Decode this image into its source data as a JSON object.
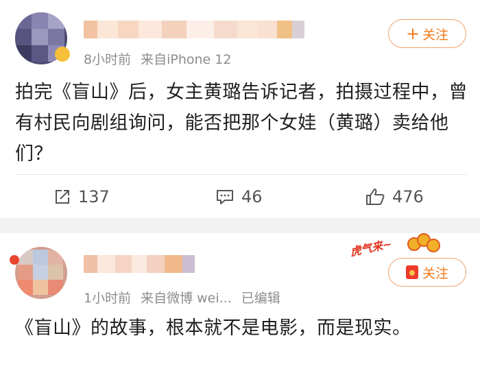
{
  "post1": {
    "meta_time": "8小时前",
    "meta_source": "来自iPhone 12",
    "follow_label": "关注",
    "follow_prefix": "+",
    "content": "拍完《盲山》后，女主黄璐告诉记者，拍摄过程中，曾有村民向剧组询问，能否把那个女娃（黄璐）卖给他们？",
    "actions": {
      "share_count": "137",
      "comment_count": "46",
      "like_count": "476"
    }
  },
  "post2": {
    "meta_time": "1小时前",
    "meta_source": "来自微博 wei...",
    "meta_edited": "已编辑",
    "follow_label": "关注",
    "banner_text": "虎气来~",
    "content": "《盲山》的故事，根本就不是电影，而是现实。"
  },
  "colors": {
    "accent": "#f07a1a",
    "follow_border": "#f0a36a",
    "meta": "#8c8c8c",
    "divider": "#f2f2f2"
  },
  "icons": [
    "share-icon",
    "comment-icon",
    "like-icon",
    "red-packet-icon"
  ]
}
